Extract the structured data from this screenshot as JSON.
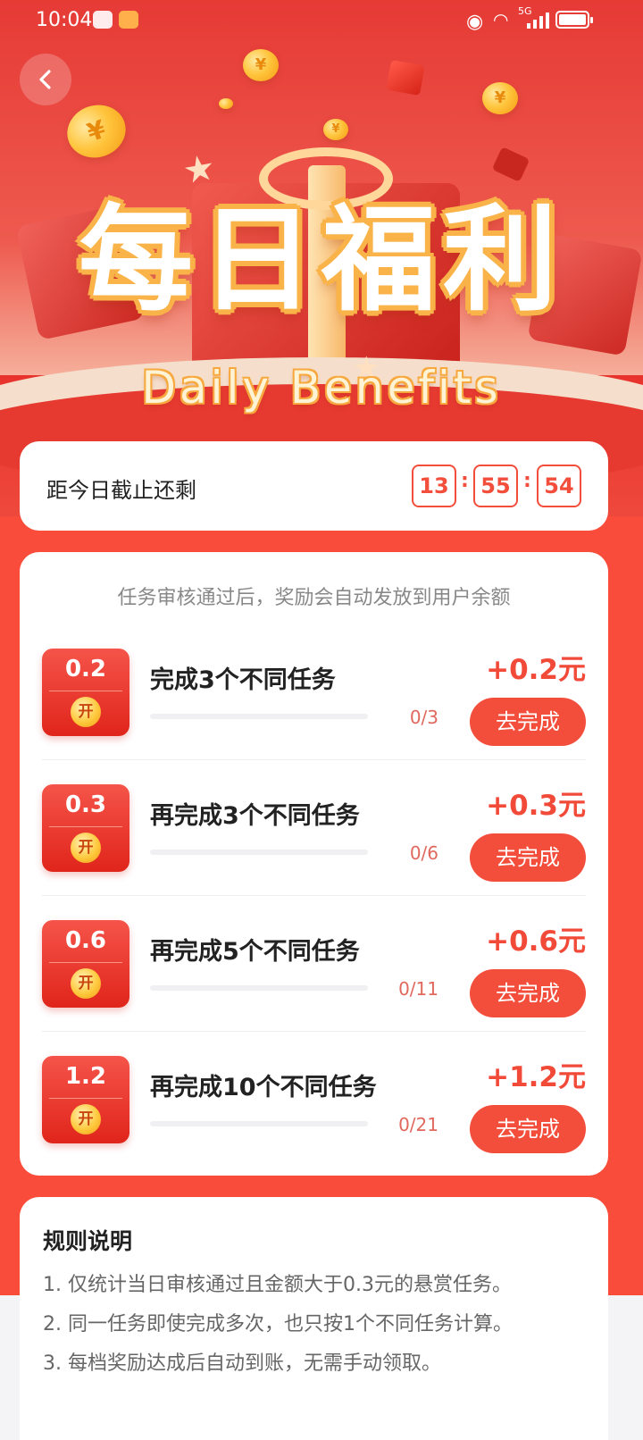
{
  "status_bar": {
    "time": "10:04",
    "network": "5G"
  },
  "banner": {
    "title_cn": "每日福利",
    "title_en": "Daily Benefits",
    "coin_symbol": "¥"
  },
  "countdown": {
    "label": "距今日截止还剩",
    "hours": "13",
    "minutes": "55",
    "seconds": "54",
    "separator": ":"
  },
  "tasks": {
    "note": "任务审核通过后，奖励会自动发放到用户余额",
    "badge_open_label": "开",
    "button_label": "去完成",
    "items": [
      {
        "badge_amount": "0.2",
        "title": "完成3个不同任务",
        "reward": "+0.2元",
        "progress_text": "0/3",
        "progress": 0
      },
      {
        "badge_amount": "0.3",
        "title": "再完成3个不同任务",
        "reward": "+0.3元",
        "progress_text": "0/6",
        "progress": 0
      },
      {
        "badge_amount": "0.6",
        "title": "再完成5个不同任务",
        "reward": "+0.6元",
        "progress_text": "0/11",
        "progress": 0
      },
      {
        "badge_amount": "1.2",
        "title": "再完成10个不同任务",
        "reward": "+1.2元",
        "progress_text": "0/21",
        "progress": 0
      }
    ]
  },
  "rules": {
    "title": "规则说明",
    "items": [
      "1. 仅统计当日审核通过且金额大于0.3元的悬赏任务。",
      "2. 同一任务即使完成多次，也只按1个不同任务计算。",
      "3. 每档奖励达成后自动到账，无需手动领取。"
    ]
  },
  "colors": {
    "accent": "#f34d3b",
    "main_bg": "#fa4c3b",
    "coin_gold": "#ffc53d"
  },
  "icons": {
    "back": "chevron-left-icon",
    "badge_coin": "coin-icon"
  }
}
